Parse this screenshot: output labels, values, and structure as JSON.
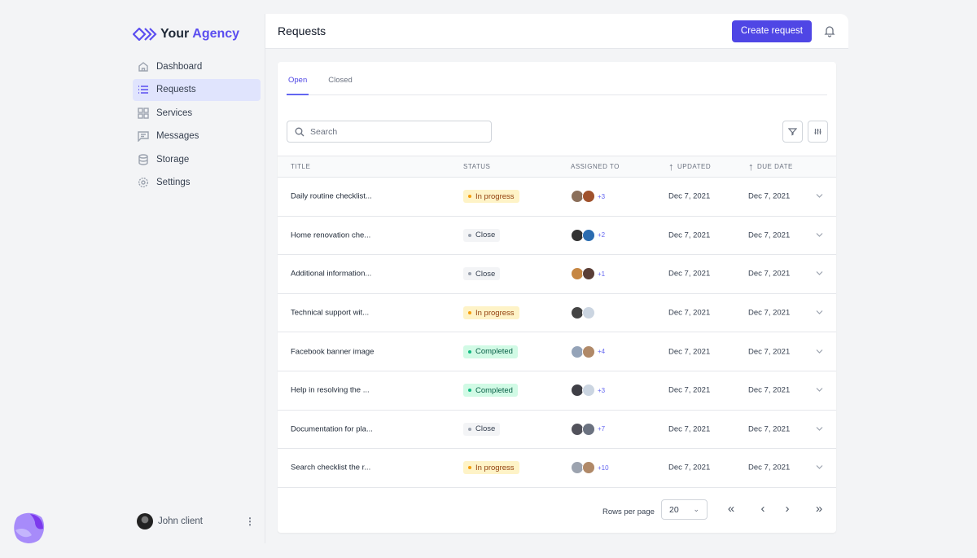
{
  "brand": {
    "name_part1": "Your",
    "name_part2": "Agency",
    "accent": "#4f46e5"
  },
  "sidebar": {
    "items": [
      {
        "label": "Dashboard",
        "icon": "home-icon"
      },
      {
        "label": "Requests",
        "icon": "list-icon",
        "active": true
      },
      {
        "label": "Services",
        "icon": "grid-icon"
      },
      {
        "label": "Messages",
        "icon": "message-icon"
      },
      {
        "label": "Storage",
        "icon": "database-icon"
      },
      {
        "label": "Settings",
        "icon": "gear-icon"
      }
    ],
    "user": {
      "name": "John client"
    }
  },
  "header": {
    "title": "Requests",
    "create_label": "Create request"
  },
  "tabs": [
    {
      "label": "Open",
      "active": true
    },
    {
      "label": "Closed"
    }
  ],
  "search": {
    "placeholder": "Search",
    "value": ""
  },
  "table": {
    "columns": [
      "TITLE",
      "STATUS",
      "ASSIGNED TO",
      "UPDATED",
      "DUE DATE"
    ],
    "rows": [
      {
        "title": "Daily routine checklist...",
        "status": "In progress",
        "extra": "+3",
        "updated": "Dec 7, 2021",
        "due": "Dec 7, 2021"
      },
      {
        "title": "Home renovation che...",
        "status": "Close",
        "extra": "+2",
        "updated": "Dec 7, 2021",
        "due": "Dec 7, 2021"
      },
      {
        "title": "Additional information...",
        "status": "Close",
        "extra": "+1",
        "updated": "Dec 7, 2021",
        "due": "Dec 7, 2021"
      },
      {
        "title": "Technical support wit...",
        "status": "In progress",
        "extra": "",
        "updated": "Dec 7, 2021",
        "due": "Dec 7, 2021"
      },
      {
        "title": "Facebook banner image",
        "status": "Completed",
        "extra": "+4",
        "updated": "Dec 7, 2021",
        "due": "Dec 7, 2021"
      },
      {
        "title": " Help in resolving the ...",
        "status": "Completed",
        "extra": "+3",
        "updated": "Dec 7, 2021",
        "due": "Dec 7, 2021"
      },
      {
        "title": "Documentation for pla...",
        "status": "Close",
        "extra": "+7",
        "updated": "Dec 7, 2021",
        "due": "Dec 7, 2021"
      },
      {
        "title": "Search checklist the r...",
        "status": "In progress",
        "extra": "+10",
        "updated": "Dec 7, 2021",
        "due": "Dec 7, 2021"
      }
    ]
  },
  "status_colors": {
    "In progress": {
      "bg": "#fef3c7",
      "fg": "#92400e",
      "dot": "#f59e0b"
    },
    "Close": {
      "bg": "#f3f4f6",
      "fg": "#374151",
      "dot": "#9ca3af"
    },
    "Completed": {
      "bg": "#d1fae5",
      "fg": "#065f46",
      "dot": "#10b981"
    }
  },
  "pagination": {
    "rows_per_page_label": "Rows per page",
    "rows_per_page": "20"
  }
}
